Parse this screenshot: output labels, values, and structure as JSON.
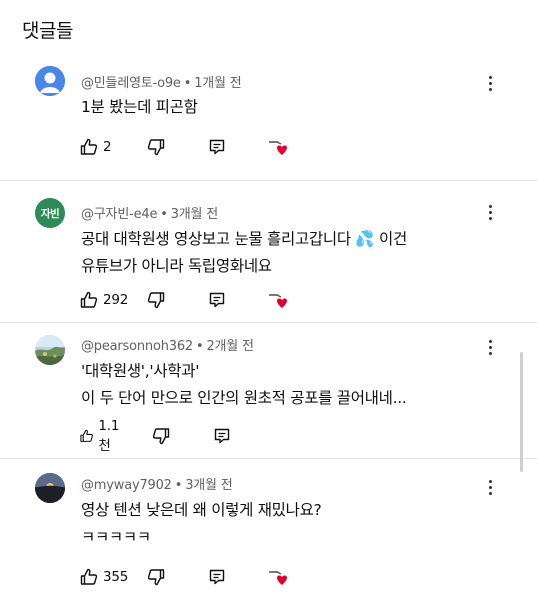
{
  "header": {
    "title": "댓글들"
  },
  "comments": [
    {
      "author": "@민들레영토-o9e",
      "age": "1개월 전",
      "avatar_text": "",
      "lines": [
        "1분 봤는데 피곤함"
      ],
      "likes": "2",
      "avatar_color": "#4a86e8"
    },
    {
      "author": "@구자빈-e4e",
      "age": "3개월 전",
      "avatar_text": "자빈",
      "lines": [
        "공대 대학원생 영상보고 눈물 흘리고갑니다 💦 이건",
        "유튜브가 아니라 독립영화네요"
      ],
      "likes": "292",
      "avatar_color": "#2e8b57"
    },
    {
      "author": "@pearsonnoh362",
      "age": "2개월 전",
      "avatar_text": "",
      "lines": [
        "'대학원생','사학과'",
        "이 두 단어 만으로 인간의 원초적 공포를 끌어내네..."
      ],
      "likes": "1.1천",
      "avatar_color": "#8fb3d9"
    },
    {
      "author": "@myway7902",
      "age": "3개월 전",
      "avatar_text": "",
      "lines": [
        "영상 텐션 낮은데 왜 이렇게 재밌나요?",
        "ㅋㅋㅋㅋㅋ"
      ],
      "likes": "355",
      "avatar_color": "#3a3a4a"
    }
  ],
  "meta_separator": "•",
  "icons": {
    "like": "thumb-up-icon",
    "dislike": "thumb-down-icon",
    "reply": "reply-icon",
    "heart": "creator-heart-icon",
    "menu": "more-vert-icon"
  }
}
